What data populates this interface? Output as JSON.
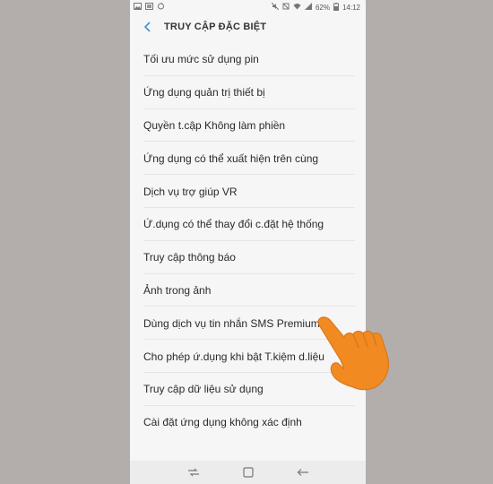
{
  "status_bar": {
    "battery": "62%",
    "time": "14:12"
  },
  "header": {
    "title": "TRUY CẬP ĐẶC BIỆT"
  },
  "items": [
    {
      "label": "Tối ưu mức sử dụng pin"
    },
    {
      "label": "Ứng dụng quản trị thiết bị"
    },
    {
      "label": "Quyền t.cập Không làm phiền"
    },
    {
      "label": "Ứng dụng có thể xuất hiện trên cùng"
    },
    {
      "label": "Dịch vụ trợ giúp VR"
    },
    {
      "label": "Ứ.dụng có thể thay đổi c.đặt hệ thống"
    },
    {
      "label": "Truy cập thông báo"
    },
    {
      "label": "Ảnh trong ảnh"
    },
    {
      "label": "Dùng dịch vụ tin nhắn SMS Premium"
    },
    {
      "label": "Cho phép ứ.dụng khi bật T.kiệm d.liệu"
    },
    {
      "label": "Truy cập dữ liệu sử dụng"
    },
    {
      "label": "Cài đặt ứng dụng không xác định"
    }
  ],
  "colors": {
    "background": "#b3aeac",
    "accent_back": "#3e8fd6",
    "hand": "#f08a21"
  },
  "icons": {
    "back": "back-arrow-icon",
    "recent": "recent-apps-icon",
    "home": "home-icon",
    "nav_back": "nav-back-icon",
    "pointer": "pointing-hand-icon"
  }
}
